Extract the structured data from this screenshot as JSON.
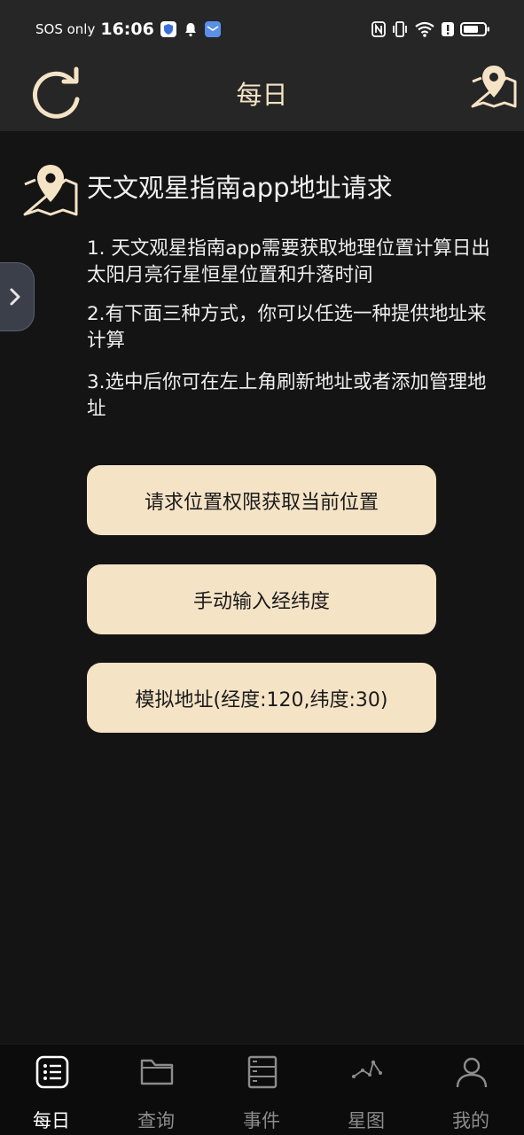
{
  "status_bar": {
    "carrier": "SOS only",
    "time": "16:06"
  },
  "app_bar": {
    "title": "每日",
    "refresh_icon": "refresh-icon",
    "map_icon": "map-location-icon"
  },
  "request": {
    "title": "天文观星指南app地址请求",
    "paragraphs": [
      "1. 天文观星指南app需要获取地理位置计算日出太阳月亮行星恒星位置和升落时间",
      "2.有下面三种方式，你可以任选一种提供地址来计算",
      "3.选中后你可在左上角刷新地址或者添加管理地址"
    ],
    "buttons": [
      "请求位置权限获取当前位置",
      "手动输入经纬度",
      "模拟地址(经度:120,纬度:30)"
    ]
  },
  "bottom_nav": {
    "items": [
      {
        "label": "每日",
        "icon": "daily-list-icon",
        "active": true
      },
      {
        "label": "查询",
        "icon": "folder-icon",
        "active": false
      },
      {
        "label": "事件",
        "icon": "events-stack-icon",
        "active": false
      },
      {
        "label": "星图",
        "icon": "constellation-icon",
        "active": false
      },
      {
        "label": "我的",
        "icon": "profile-icon",
        "active": false
      }
    ]
  },
  "colors": {
    "accent": "#f5e3c6",
    "background": "#141414",
    "bar": "#262626"
  }
}
